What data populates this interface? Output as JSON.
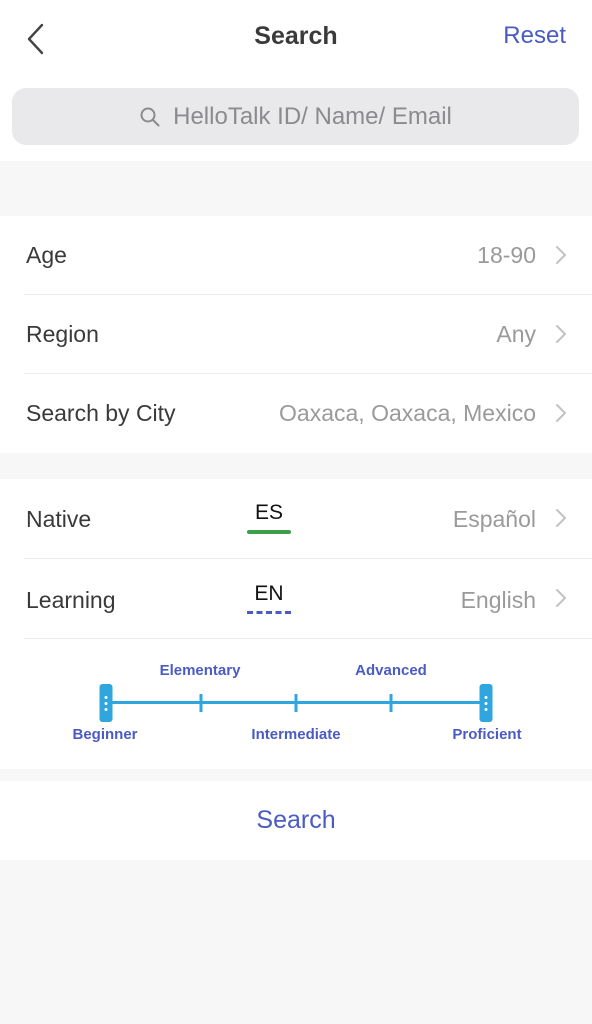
{
  "header": {
    "title": "Search",
    "reset_label": "Reset"
  },
  "search": {
    "placeholder": "HelloTalk ID/ Name/ Email"
  },
  "filters": {
    "age": {
      "label": "Age",
      "value": "18-90"
    },
    "region": {
      "label": "Region",
      "value": "Any"
    },
    "city": {
      "label": "Search by City",
      "value": "Oaxaca, Oaxaca, Mexico"
    }
  },
  "languages": {
    "native": {
      "label": "Native",
      "code": "ES",
      "value": "Español",
      "underline_color": "#3f9e4a"
    },
    "learning": {
      "label": "Learning",
      "code": "EN",
      "value": "English",
      "underline_color": "#4a5bc4"
    }
  },
  "level_slider": {
    "levels": [
      "Beginner",
      "Elementary",
      "Intermediate",
      "Advanced",
      "Proficient"
    ],
    "selected_min": "Beginner",
    "selected_max": "Proficient"
  },
  "footer": {
    "search_label": "Search"
  },
  "colors": {
    "accent": "#4a5bc4",
    "slider": "#2fa6de"
  }
}
